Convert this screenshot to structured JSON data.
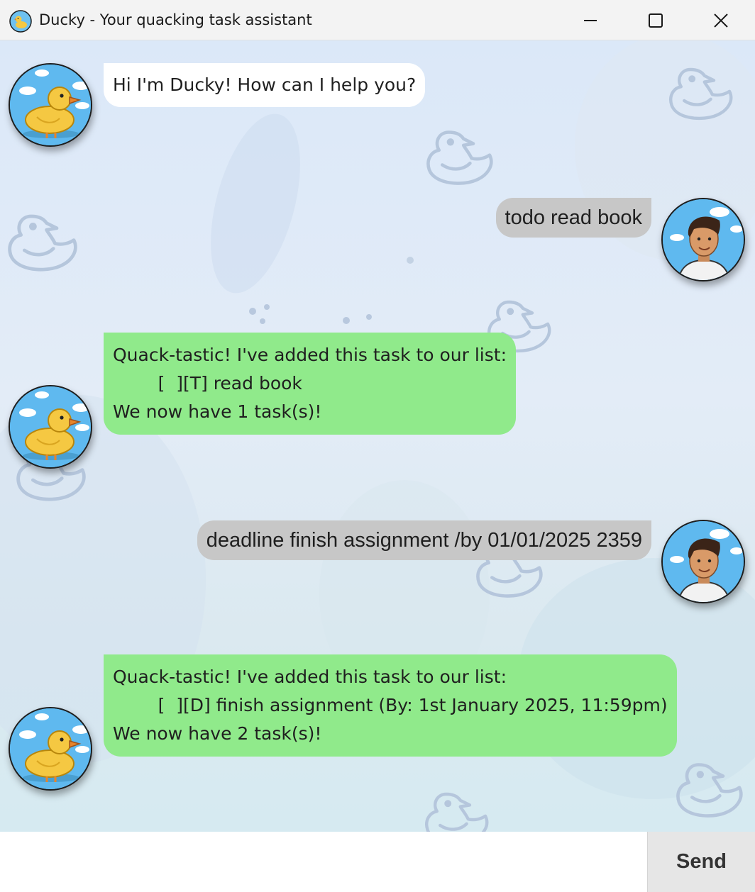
{
  "window": {
    "title": "Ducky - Your quacking task assistant",
    "icon": "duck-app-icon",
    "controls": [
      "minimize-icon",
      "maximize-icon",
      "close-icon"
    ]
  },
  "messages": [
    {
      "sender": "bot",
      "style": "white",
      "text": "Hi I'm Ducky! How can I help you?"
    },
    {
      "sender": "user",
      "text": "todo read book"
    },
    {
      "sender": "bot",
      "style": "green",
      "text": "Quack-tastic! I've added this task to our list:\n        [  ][T] read book\nWe now have 1 task(s)!"
    },
    {
      "sender": "user",
      "text": "deadline finish assignment /by 01/01/2025 2359"
    },
    {
      "sender": "bot",
      "style": "green",
      "text": "Quack-tastic! I've added this task to our list:\n        [  ][D] finish assignment (By: 1st January 2025, 11:59pm)\nWe now have 2 task(s)!"
    }
  ],
  "input": {
    "value": "",
    "placeholder": ""
  },
  "send_button": {
    "label": "Send"
  },
  "colors": {
    "bot_bubble_white": "#ffffff",
    "bot_bubble_green": "#90ea8b",
    "user_bubble": "#c7c7c7",
    "background": "#dbe8f8"
  }
}
